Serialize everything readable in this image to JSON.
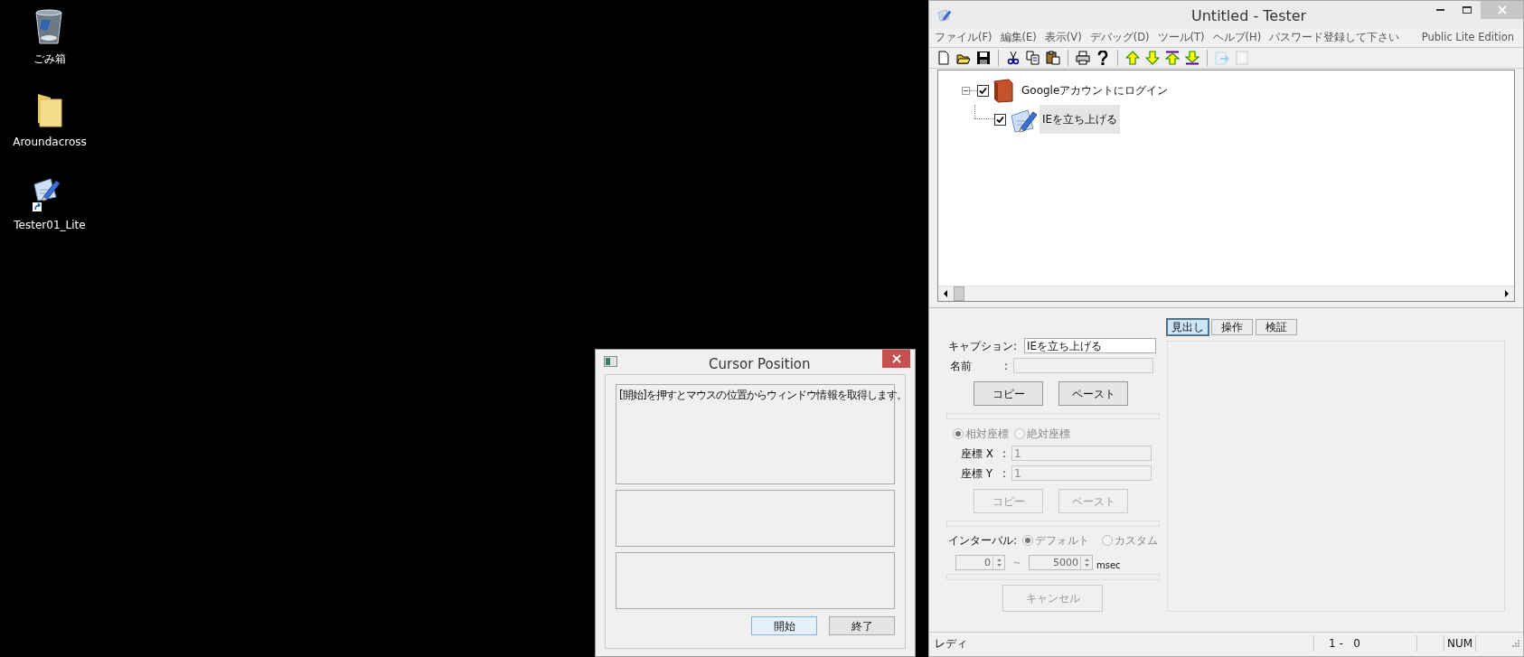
{
  "desktop_icons": [
    {
      "label": "ごみ箱",
      "kind": "recycle-bin"
    },
    {
      "label": "Aroundacross",
      "kind": "folder"
    },
    {
      "label": "Tester01_Lite",
      "kind": "app-shortcut"
    }
  ],
  "tester_window": {
    "title": "Untitled - Tester",
    "menu": [
      "ファイル(F)",
      "編集(E)",
      "表示(V)",
      "デバッグ(D)",
      "ツール(T)",
      "ヘルプ(H)",
      "パスワード登録して下さい"
    ],
    "edition": "Public Lite Edition",
    "toolbar": [
      {
        "kind": "new",
        "disabled": false
      },
      {
        "kind": "open",
        "disabled": false
      },
      {
        "kind": "save",
        "disabled": false
      },
      {
        "kind": "separator",
        "disabled": false
      },
      {
        "kind": "cut",
        "disabled": false
      },
      {
        "kind": "copy",
        "disabled": false
      },
      {
        "kind": "paste",
        "disabled": false
      },
      {
        "kind": "separator",
        "disabled": false
      },
      {
        "kind": "print",
        "disabled": false
      },
      {
        "kind": "help",
        "disabled": false
      },
      {
        "kind": "separator",
        "disabled": false
      },
      {
        "kind": "up",
        "disabled": false
      },
      {
        "kind": "down",
        "disabled": false
      },
      {
        "kind": "top",
        "disabled": false
      },
      {
        "kind": "bottom",
        "disabled": false
      },
      {
        "kind": "separator",
        "disabled": false
      },
      {
        "kind": "export",
        "disabled": true
      },
      {
        "kind": "blank",
        "disabled": true
      }
    ],
    "tree": [
      {
        "label": "Googleアカウントにログイン",
        "kind": "book",
        "checked": true,
        "selected": false,
        "expanded": true,
        "children": [
          {
            "label": "IEを立ち上げる",
            "kind": "step",
            "checked": true,
            "selected": true
          }
        ]
      }
    ],
    "form": {
      "caption": {
        "label": "キャプション:",
        "value": "IEを立ち上げる"
      },
      "name": {
        "label": "名前",
        "separator": ":",
        "disabled": true
      },
      "buttons_1": [
        {
          "label": "コピー",
          "disabled": false
        },
        {
          "label": "ペースト",
          "disabled": false
        }
      ],
      "coordinate_modes": [
        {
          "label": "相対座標",
          "selected": true
        },
        {
          "label": "絶対座標",
          "selected": false
        }
      ],
      "coordinates": [
        {
          "label": "座標 X",
          "separator": ":",
          "value": "1"
        },
        {
          "label": "座標 Y",
          "separator": ":",
          "value": "1"
        }
      ],
      "buttons_2": [
        {
          "label": "コピー",
          "disabled": true
        },
        {
          "label": "ペースト",
          "disabled": true
        }
      ],
      "interval": {
        "label": "インターバル:",
        "options": [
          {
            "label": "デフォルト",
            "selected": true
          },
          {
            "label": "カスタム",
            "selected": false
          }
        ],
        "min": "0",
        "tilde": "～",
        "max": "5000",
        "unit": "msec"
      },
      "cancel": {
        "label": "キャンセル",
        "disabled": true
      }
    },
    "tabs": [
      {
        "label": "見出し",
        "selected": true
      },
      {
        "label": "操作",
        "selected": false
      },
      {
        "label": "検証",
        "selected": false
      }
    ],
    "status_bar": [
      "レディ",
      "1 -   0",
      "NUM"
    ]
  },
  "cursor_dialog": {
    "title": "Cursor Position",
    "message": "[開始]を押すとマウスの位置からウィンドウ情報を取得します。",
    "buttons": [
      {
        "label": "開始",
        "default": true
      },
      {
        "label": "終了",
        "default": false
      }
    ]
  }
}
